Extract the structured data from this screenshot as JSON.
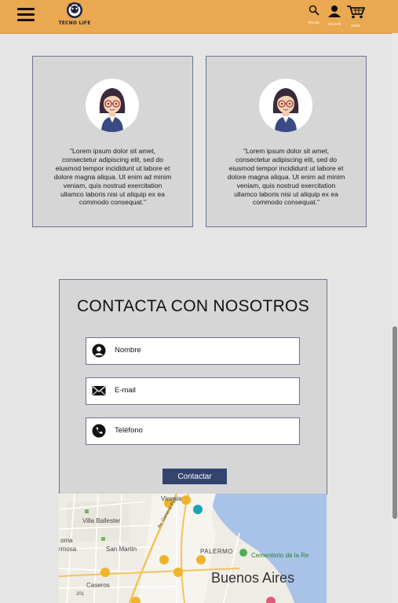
{
  "header": {
    "logo_text": "TECNO LIFE",
    "search_label": "Buscar",
    "profile_label": "Mi perfil",
    "cart_label": "carrito"
  },
  "testimonials": [
    {
      "quote": "\"Lorem ipsum dolor sit amet, consectetur adipiscing elit, sed do eiusmod tempor incididunt ut labore et dolore magna aliqua. Ut enim ad minim veniam, quis nostrud exercitation ullamco laboris nisi ut aliquip ex ea commodo consequat.\""
    },
    {
      "quote": "\"Lorem ipsum dolor sit amet, consectetur adipiscing elit, sed do eiusmod tempor incididunt ut labore et dolore magna aliqua. Ut enim ad minim veniam, quis nostrud exercitation ullamco laboris nisi ut aliquip ex ea commodo consequat.\""
    }
  ],
  "contact": {
    "title": "CONTACTA CON NOSOTROS",
    "name_placeholder": "Nombre",
    "email_placeholder": "E-mail",
    "phone_placeholder": "Teléfono",
    "submit_label": "Contactar"
  },
  "map": {
    "city_label": "Buenos Aires",
    "places": {
      "villa_ballester": "Villa Ballester",
      "san_martin": "San Martín",
      "caseros": "Caseros",
      "palermo": "PALERMO",
      "cementerio": "Cementerio de la Re",
      "vicente": "Vicente",
      "roma": "oma",
      "ermosa": "rmosa",
      "avenida": "Av. General Paz",
      "route_201": "201"
    }
  },
  "colors": {
    "header": "#eaa851",
    "card": "#d6d6d6",
    "border": "#6c7490",
    "button": "#33446f"
  }
}
